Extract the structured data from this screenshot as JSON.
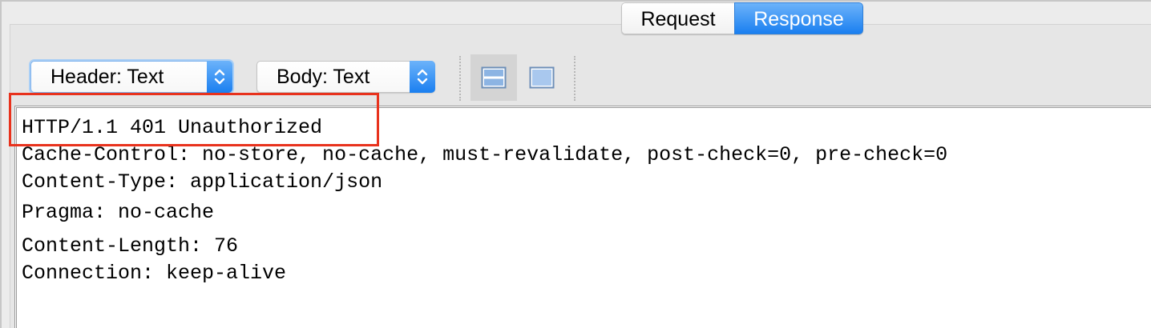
{
  "tabs": [
    {
      "label": "Request",
      "selected": false
    },
    {
      "label": "Response",
      "selected": true
    }
  ],
  "toolbar": {
    "header_select": {
      "value": "Header: Text"
    },
    "body_select": {
      "value": "Body: Text"
    },
    "view_buttons": [
      {
        "icon": "split-view-icon",
        "active": true
      },
      {
        "icon": "single-view-icon",
        "active": false
      }
    ]
  },
  "response": {
    "status_line": "HTTP/1.1 401 Unauthorized",
    "headers": [
      "Cache-Control: no-store, no-cache, must-revalidate, post-check=0, pre-check=0",
      "Content-Type: application/json",
      "Pragma: no-cache",
      "Content-Length: 76",
      "Connection: keep-alive"
    ]
  },
  "colors": {
    "accent": "#1a7ff0",
    "highlight": "#e8321d"
  }
}
